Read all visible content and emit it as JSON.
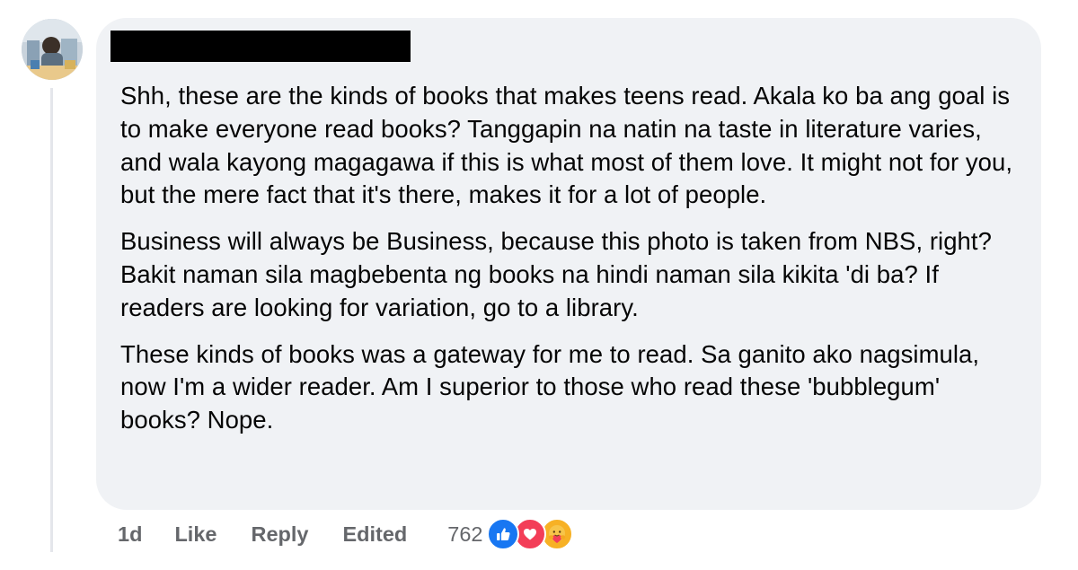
{
  "comment": {
    "author_redacted": true,
    "paragraphs": [
      "Shh, these are the kinds of books that makes teens read. Akala ko ba ang goal is to make everyone read books? Tanggapin na natin na taste in literature varies, and wala kayong magagawa if this is what most of them love. It might not for you, but the mere fact that it's there, makes it for a lot of people.",
      "Business will always be Business, because this photo is taken from NBS, right? Bakit naman sila magbebenta ng books na hindi naman sila kikita 'di ba? If readers are looking for variation, go to a library.",
      "These kinds of books was a gateway for me to read. Sa ganito ako nagsimula, now I'm a wider reader. Am I superior to those who read these 'bubblegum' books? Nope."
    ]
  },
  "actions": {
    "time": "1d",
    "like": "Like",
    "reply": "Reply",
    "edited": "Edited"
  },
  "reactions": {
    "count": "762",
    "types": [
      "like-icon",
      "love-icon",
      "care-icon"
    ],
    "colors": {
      "like": "#1877f2",
      "love": "#f33e58",
      "care": "#f7b125"
    }
  }
}
